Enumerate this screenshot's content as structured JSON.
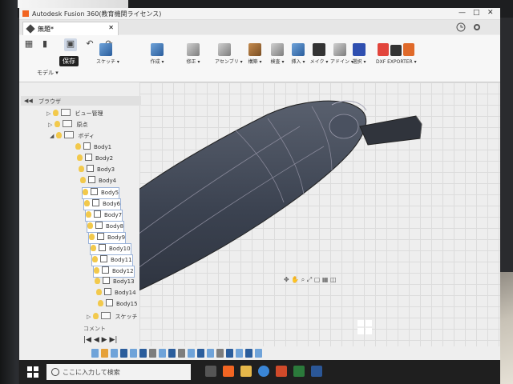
{
  "window": {
    "title": "Autodesk Fusion 360(教育機関ライセンス)",
    "minimize": "—",
    "maximize": "□",
    "close": "✕"
  },
  "tab": {
    "label": "無題*",
    "close": "✕"
  },
  "quick_access": {
    "save_tooltip": "保存"
  },
  "workspace": {
    "label": "モデル ▾"
  },
  "tools": [
    {
      "label": "スケッチ ▾",
      "icon": "sketch-icon",
      "color": "#6fa3d9"
    },
    {
      "label": "作成 ▾",
      "icon": "extrude-icon",
      "color": "#2a5d9c"
    },
    {
      "label": "修正 ▾",
      "icon": "modify-icon",
      "color": "#7d7d7d"
    },
    {
      "label": "アセンブリ ▾",
      "icon": "assemble-icon",
      "color": "#7d7d7d"
    },
    {
      "label": "構築 ▾",
      "icon": "construct-icon",
      "color": "#c58b4e"
    },
    {
      "label": "検査 ▾",
      "icon": "inspect-icon",
      "color": "#7d7d7d"
    },
    {
      "label": "挿入 ▾",
      "icon": "insert-icon",
      "color": "#2a5d9c"
    },
    {
      "label": "メイク ▾",
      "icon": "make-icon",
      "color": "#333333"
    },
    {
      "label": "アドイン ▾",
      "icon": "addins-icon",
      "color": "#7d7d7d"
    },
    {
      "label": "選択 ▾",
      "icon": "select-icon",
      "color": "#2f4fb0"
    },
    {
      "label": "DXF EXPORTER ▾",
      "icon": "dxf-exporter-icon",
      "color": "#e2453c"
    }
  ],
  "browser": {
    "title": "ブラウザ",
    "folders": [
      {
        "label": "ビュー管理"
      },
      {
        "label": "原点"
      },
      {
        "label": "ボディ"
      }
    ],
    "bodies": [
      "Body1",
      "Body2",
      "Body3",
      "Body4",
      "Body5",
      "Body6",
      "Body7",
      "Body8",
      "Body9",
      "Body10",
      "Body11",
      "Body12",
      "Body13",
      "Body14",
      "Body15"
    ],
    "sketch_folder": "スケッチ"
  },
  "comments": {
    "label": "コメント"
  },
  "timeline": {
    "first": "|◀",
    "prev": "◀",
    "play": "▶",
    "next": "▶|"
  },
  "taskbar": {
    "search_placeholder": "ここに入力して検索"
  },
  "colors": {
    "accent": "#f26522",
    "selection": "#9bb3d9",
    "taskbar": "#1f1f1f",
    "model": "#3b4250"
  }
}
